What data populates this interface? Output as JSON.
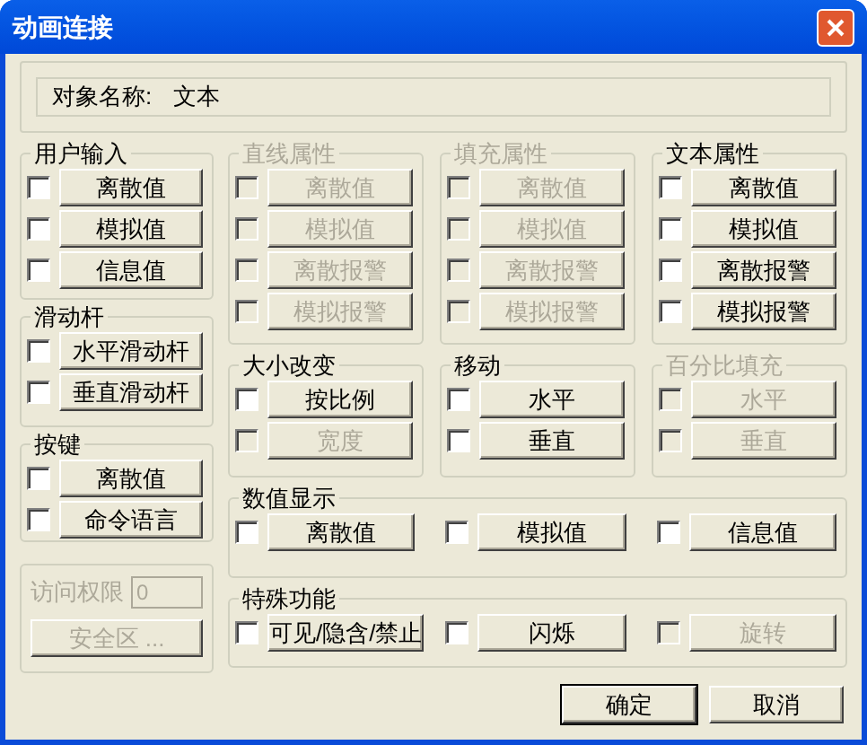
{
  "window": {
    "title": "动画连接"
  },
  "object_name": {
    "label": "对象名称:",
    "value": "文本"
  },
  "left_groups": [
    {
      "title": "用户输入",
      "disabled": false,
      "items": [
        {
          "label": "离散值",
          "checked": false,
          "disabled": false
        },
        {
          "label": "模拟值",
          "checked": false,
          "disabled": false
        },
        {
          "label": "信息值",
          "checked": false,
          "disabled": false
        }
      ]
    },
    {
      "title": "滑动杆",
      "disabled": false,
      "items": [
        {
          "label": "水平滑动杆",
          "checked": false,
          "disabled": false
        },
        {
          "label": "垂直滑动杆",
          "checked": false,
          "disabled": false
        }
      ]
    },
    {
      "title": "按键",
      "disabled": false,
      "items": [
        {
          "label": "离散值",
          "checked": false,
          "disabled": false
        },
        {
          "label": "命令语言",
          "checked": false,
          "disabled": false
        }
      ]
    }
  ],
  "access": {
    "label": "访问权限",
    "value": "0",
    "disabled": true,
    "button": "安全区 ..."
  },
  "property_groups": [
    {
      "title": "直线属性",
      "disabled": true,
      "items": [
        {
          "label": "离散值",
          "checked": false,
          "disabled": true
        },
        {
          "label": "模拟值",
          "checked": false,
          "disabled": true
        },
        {
          "label": "离散报警",
          "checked": false,
          "disabled": true
        },
        {
          "label": "模拟报警",
          "checked": false,
          "disabled": true
        }
      ]
    },
    {
      "title": "填充属性",
      "disabled": true,
      "items": [
        {
          "label": "离散值",
          "checked": false,
          "disabled": true
        },
        {
          "label": "模拟值",
          "checked": false,
          "disabled": true
        },
        {
          "label": "离散报警",
          "checked": false,
          "disabled": true
        },
        {
          "label": "模拟报警",
          "checked": false,
          "disabled": true
        }
      ]
    },
    {
      "title": "文本属性",
      "disabled": false,
      "items": [
        {
          "label": "离散值",
          "checked": false,
          "disabled": false
        },
        {
          "label": "模拟值",
          "checked": false,
          "disabled": false
        },
        {
          "label": "离散报警",
          "checked": false,
          "disabled": false
        },
        {
          "label": "模拟报警",
          "checked": false,
          "disabled": false
        }
      ]
    }
  ],
  "transform_groups": [
    {
      "title": "大小改变",
      "disabled": false,
      "items": [
        {
          "label": "按比例",
          "checked": false,
          "disabled": false
        },
        {
          "label": "宽度",
          "checked": false,
          "disabled": true
        }
      ]
    },
    {
      "title": "移动",
      "disabled": false,
      "items": [
        {
          "label": "水平",
          "checked": false,
          "disabled": false
        },
        {
          "label": "垂直",
          "checked": false,
          "disabled": false
        }
      ]
    },
    {
      "title": "百分比填充",
      "disabled": true,
      "items": [
        {
          "label": "水平",
          "checked": false,
          "disabled": true
        },
        {
          "label": "垂直",
          "checked": false,
          "disabled": true
        }
      ]
    }
  ],
  "value_display": {
    "title": "数值显示",
    "disabled": false,
    "items": [
      {
        "label": "离散值",
        "checked": false,
        "disabled": false
      },
      {
        "label": "模拟值",
        "checked": false,
        "disabled": false
      },
      {
        "label": "信息值",
        "checked": false,
        "disabled": false
      }
    ]
  },
  "special": {
    "title": "特殊功能",
    "disabled": false,
    "items": [
      {
        "label": "可见/隐含/禁止",
        "checked": false,
        "disabled": false
      },
      {
        "label": "闪烁",
        "checked": false,
        "disabled": false
      },
      {
        "label": "旋转",
        "checked": false,
        "disabled": true
      }
    ]
  },
  "buttons": [
    {
      "label": "确定",
      "default": true
    },
    {
      "label": "取消",
      "default": false
    }
  ]
}
